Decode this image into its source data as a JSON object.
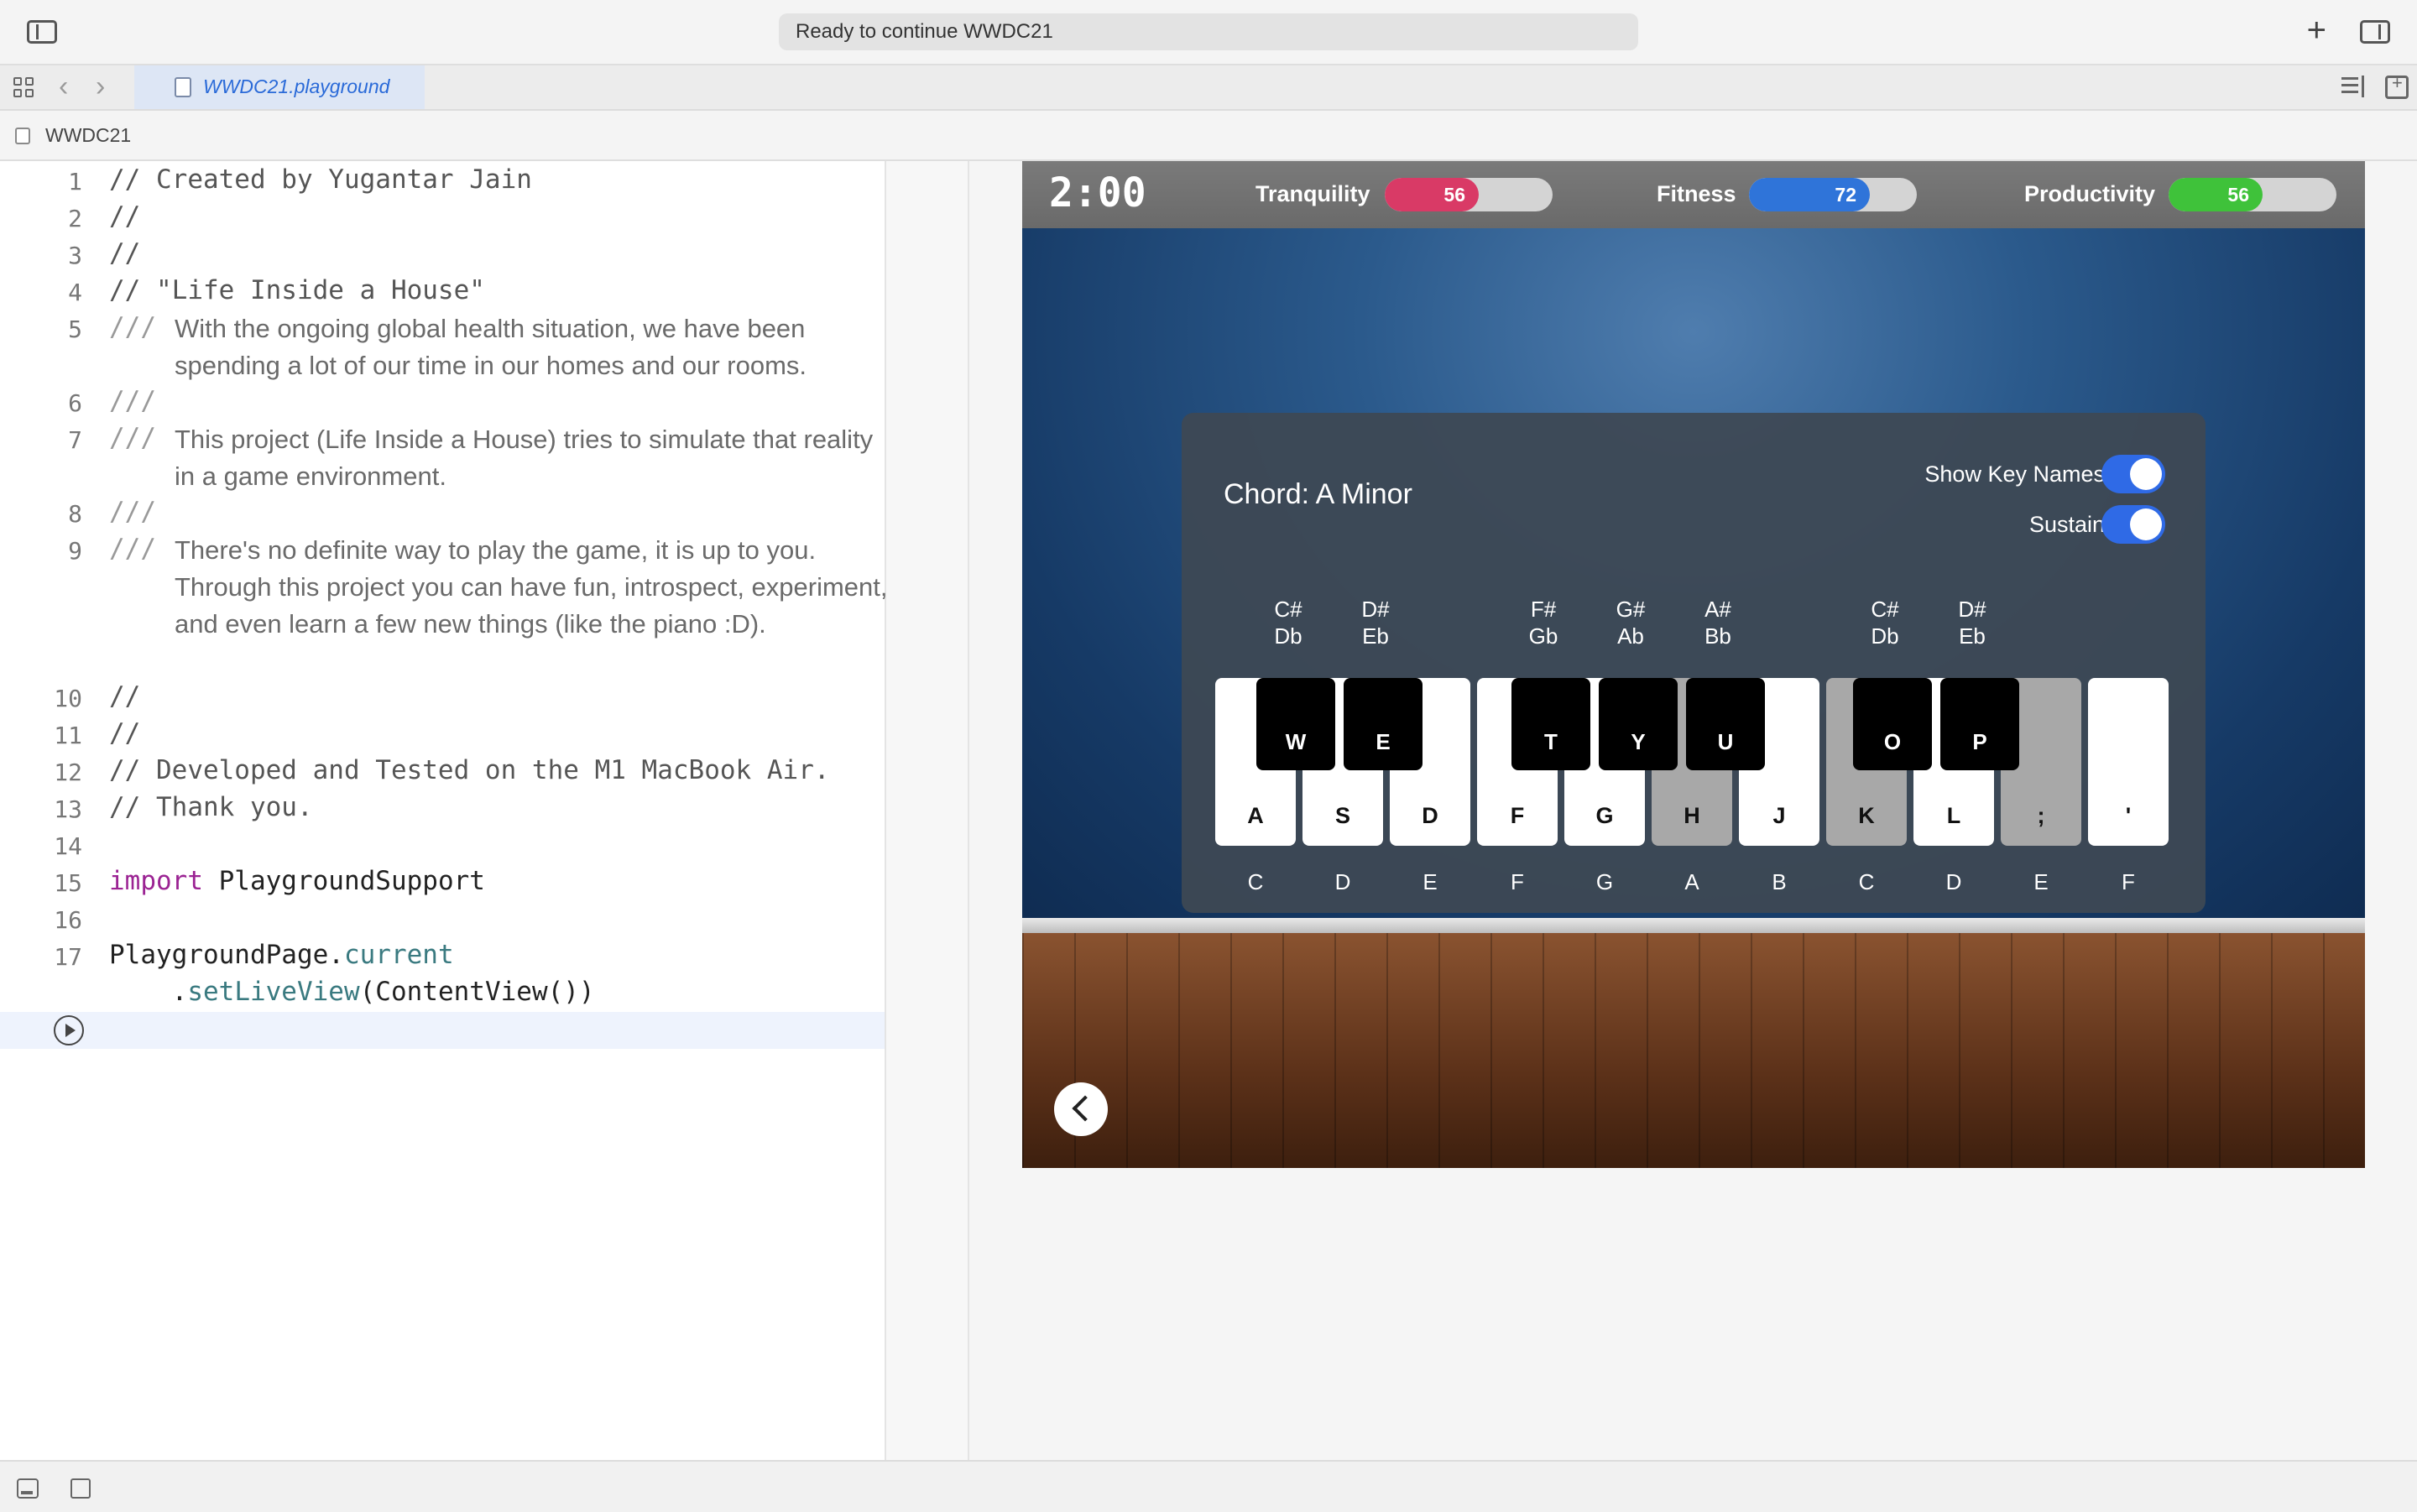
{
  "toolbar": {
    "activity_text": "Ready to continue WWDC21"
  },
  "tabs": [
    {
      "label": "WWDC21.playground",
      "active": true
    }
  ],
  "breadcrumb": {
    "label": "WWDC21"
  },
  "editor": {
    "line_numbers": [
      "1",
      "2",
      "3",
      "4",
      "5",
      "6",
      "7",
      "8",
      "9",
      "10",
      "11",
      "12",
      "13",
      "14",
      "15",
      "16",
      "17"
    ],
    "lines": {
      "l1": "// Created by Yugantar Jain",
      "l2": "//",
      "l3": "//",
      "l4": "// \"Life Inside a House\"",
      "l5_prefix": "///",
      "l5_doc": "With the ongoing global health situation, we have been spending a lot of our time in our homes and our rooms.",
      "l6": "///",
      "l7_prefix": "///",
      "l7_doc": "This project (Life Inside a House) tries to simulate that reality in a game environment.",
      "l8": "///",
      "l9_prefix": "///",
      "l9_doc": "There's no definite way to play the game, it is up to you. Through this project you can have fun, introspect, experiment, and even learn a few new things (like the piano :D).",
      "l10": "//",
      "l11": "//",
      "l12": "// Developed and Tested on the M1 MacBook Air.",
      "l13": "// Thank you.",
      "l15_kw": "import",
      "l15_rest": " PlaygroundSupport",
      "l17_a": "PlaygroundPage.",
      "l17_b": "current",
      "l17c_indent": "    .",
      "l17c_method": "setLiveView",
      "l17c_rest": "(ContentView())"
    }
  },
  "liveview": {
    "timer": "2:00",
    "stats": [
      {
        "label": "Tranquility",
        "value": "56",
        "fraction": 0.56,
        "color": "#d93a66"
      },
      {
        "label": "Fitness",
        "value": "72",
        "fraction": 0.72,
        "color": "#2f74d9"
      },
      {
        "label": "Productivity",
        "value": "56",
        "fraction": 0.56,
        "color": "#3fc23a"
      }
    ],
    "piano": {
      "chord": "Chord: A Minor",
      "toggles": [
        {
          "label": "Show Key Names",
          "on": true
        },
        {
          "label": "Sustain",
          "on": true
        }
      ],
      "sharp_labels": [
        {
          "top": "C#",
          "bottom": "Db"
        },
        {
          "top": "D#",
          "bottom": "Eb"
        },
        {
          "top": "F#",
          "bottom": "Gb"
        },
        {
          "top": "G#",
          "bottom": "Ab"
        },
        {
          "top": "A#",
          "bottom": "Bb"
        },
        {
          "top": "C#",
          "bottom": "Db"
        },
        {
          "top": "D#",
          "bottom": "Eb"
        }
      ],
      "white_keys": [
        {
          "key": "A",
          "note": "C",
          "pressed": false
        },
        {
          "key": "S",
          "note": "D",
          "pressed": false
        },
        {
          "key": "D",
          "note": "E",
          "pressed": false
        },
        {
          "key": "F",
          "note": "F",
          "pressed": false
        },
        {
          "key": "G",
          "note": "G",
          "pressed": false
        },
        {
          "key": "H",
          "note": "A",
          "pressed": true
        },
        {
          "key": "J",
          "note": "B",
          "pressed": false
        },
        {
          "key": "K",
          "note": "C",
          "pressed": true
        },
        {
          "key": "L",
          "note": "D",
          "pressed": false
        },
        {
          "key": ";",
          "note": "E",
          "pressed": true
        },
        {
          "key": "'",
          "note": "F",
          "pressed": false
        }
      ],
      "black_keys": [
        "W",
        "E",
        "T",
        "Y",
        "U",
        "O",
        "P"
      ]
    }
  }
}
